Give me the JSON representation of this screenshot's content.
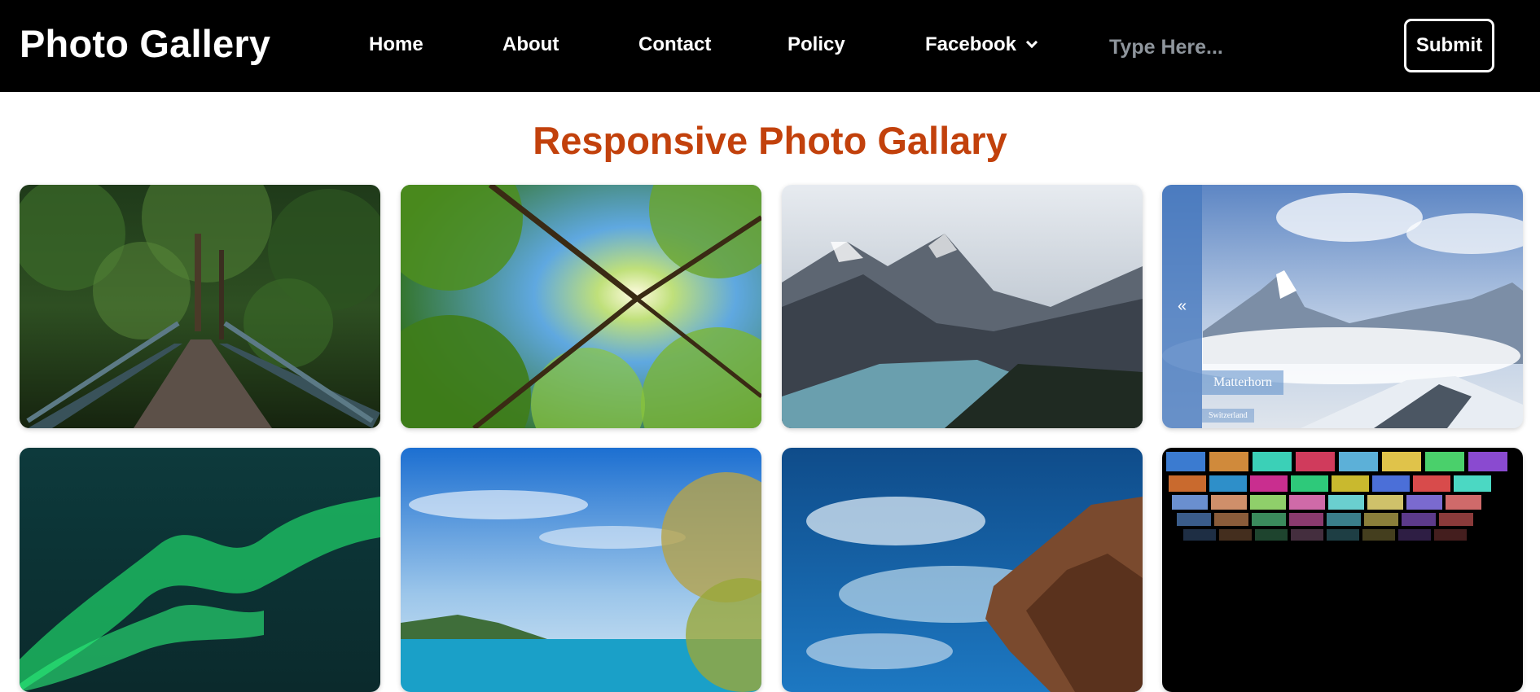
{
  "header": {
    "brand": "Photo Gallery",
    "nav": [
      "Home",
      "About",
      "Contact",
      "Policy",
      "Facebook"
    ],
    "search_placeholder": "Type Here...",
    "submit_label": "Submit"
  },
  "main": {
    "title": "Responsive Photo Gallary",
    "slider_caption": {
      "title": "Matterhorn",
      "subtitle": "Switzerland",
      "prev_icon": "«"
    }
  },
  "colors": {
    "navbar": "#000000",
    "title": "#c2410c",
    "slider_tab": "#4678be"
  },
  "icons": {
    "facebook_dropdown": "chevron-down-icon",
    "slider_prev": "double-chevron-left-icon"
  }
}
